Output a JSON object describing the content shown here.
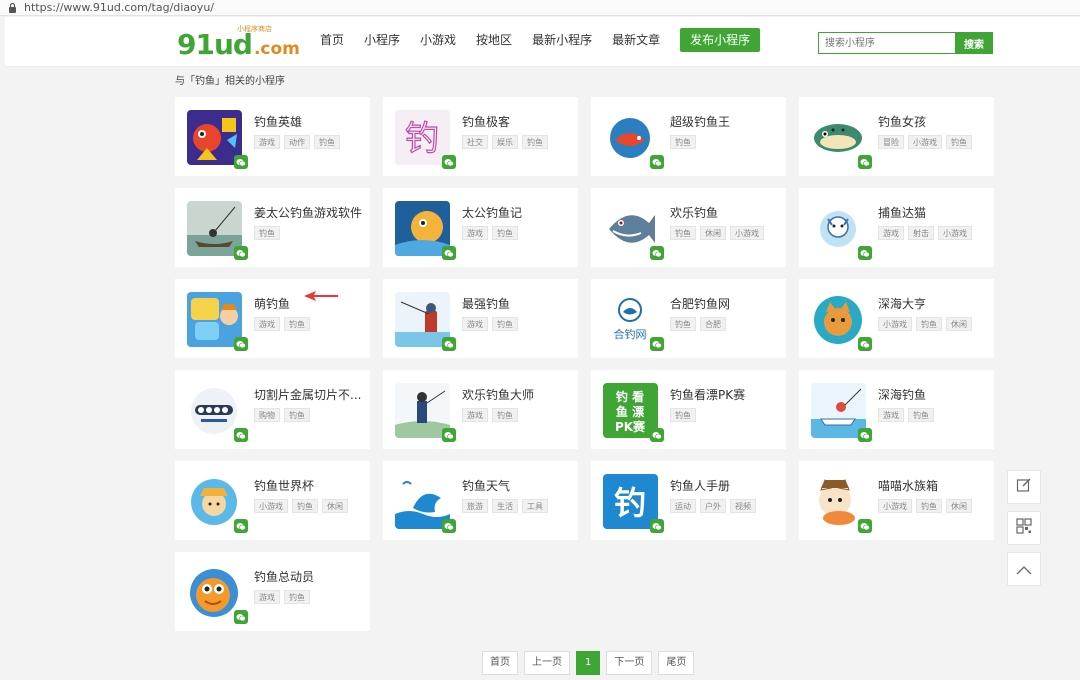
{
  "browser": {
    "url": "https://www.91ud.com/tag/diaoyu/"
  },
  "header": {
    "logo_main": "91ud",
    "logo_dot": ".com",
    "logo_slogan": "小程序商店",
    "nav": [
      {
        "label": "首页"
      },
      {
        "label": "小程序"
      },
      {
        "label": "小游戏"
      },
      {
        "label": "按地区"
      },
      {
        "label": "最新小程序"
      },
      {
        "label": "最新文章"
      },
      {
        "label": "发布小程序"
      }
    ],
    "search_placeholder": "搜索小程序",
    "search_button": "搜索"
  },
  "breadcrumb": "与「钓鱼」相关的小程序",
  "apps": [
    {
      "name": "钓鱼英雄",
      "tags": [
        "游戏",
        "动作",
        "钓鱼"
      ]
    },
    {
      "name": "钓鱼极客",
      "tags": [
        "社交",
        "娱乐",
        "钓鱼"
      ]
    },
    {
      "name": "超级钓鱼王",
      "tags": [
        "钓鱼"
      ]
    },
    {
      "name": "钓鱼女孩",
      "tags": [
        "冒险",
        "小游戏",
        "钓鱼"
      ]
    },
    {
      "name": "姜太公钓鱼游戏软件",
      "tags": [
        "钓鱼"
      ]
    },
    {
      "name": "太公钓鱼记",
      "tags": [
        "游戏",
        "钓鱼"
      ]
    },
    {
      "name": "欢乐钓鱼",
      "tags": [
        "钓鱼",
        "休闲",
        "小游戏"
      ]
    },
    {
      "name": "捕鱼达猫",
      "tags": [
        "游戏",
        "射击",
        "小游戏"
      ]
    },
    {
      "name": "萌钓鱼",
      "tags": [
        "游戏",
        "钓鱼"
      ]
    },
    {
      "name": "最强钓鱼",
      "tags": [
        "游戏",
        "钓鱼"
      ]
    },
    {
      "name": "合肥钓鱼网",
      "tags": [
        "钓鱼",
        "合肥"
      ]
    },
    {
      "name": "深海大亨",
      "tags": [
        "小游戏",
        "钓鱼",
        "休闲"
      ]
    },
    {
      "name": "切割片金属切片不...",
      "tags": [
        "购物",
        "钓鱼"
      ]
    },
    {
      "name": "欢乐钓鱼大师",
      "tags": [
        "游戏",
        "钓鱼"
      ]
    },
    {
      "name": "钓鱼看漂PK赛",
      "tags": [
        "钓鱼"
      ]
    },
    {
      "name": "深海钓鱼",
      "tags": [
        "游戏",
        "钓鱼"
      ]
    },
    {
      "name": "钓鱼世界杯",
      "tags": [
        "小游戏",
        "钓鱼",
        "休闲"
      ]
    },
    {
      "name": "钓鱼天气",
      "tags": [
        "旅游",
        "生活",
        "工具"
      ]
    },
    {
      "name": "钓鱼人手册",
      "tags": [
        "运动",
        "户外",
        "视频"
      ]
    },
    {
      "name": "喵喵水族箱",
      "tags": [
        "小游戏",
        "钓鱼",
        "休闲"
      ]
    },
    {
      "name": "钓鱼总动员",
      "tags": [
        "游戏",
        "钓鱼"
      ]
    }
  ],
  "icon_glyphs": {
    "钓鱼看漂PK赛": "钓 看\n鱼 漂\nPK赛",
    "钓鱼人手册": "钓",
    "钓鱼极客": "钓",
    "合肥钓鱼网": "合钓网"
  },
  "pagination": [
    {
      "label": "首页"
    },
    {
      "label": "上一页"
    },
    {
      "label": "1",
      "current": true
    },
    {
      "label": "下一页"
    },
    {
      "label": "尾页"
    }
  ],
  "colors": {
    "brand": "#3fa535",
    "logo_accent": "#e08a1e",
    "annotation_arrow": "#e53935"
  }
}
